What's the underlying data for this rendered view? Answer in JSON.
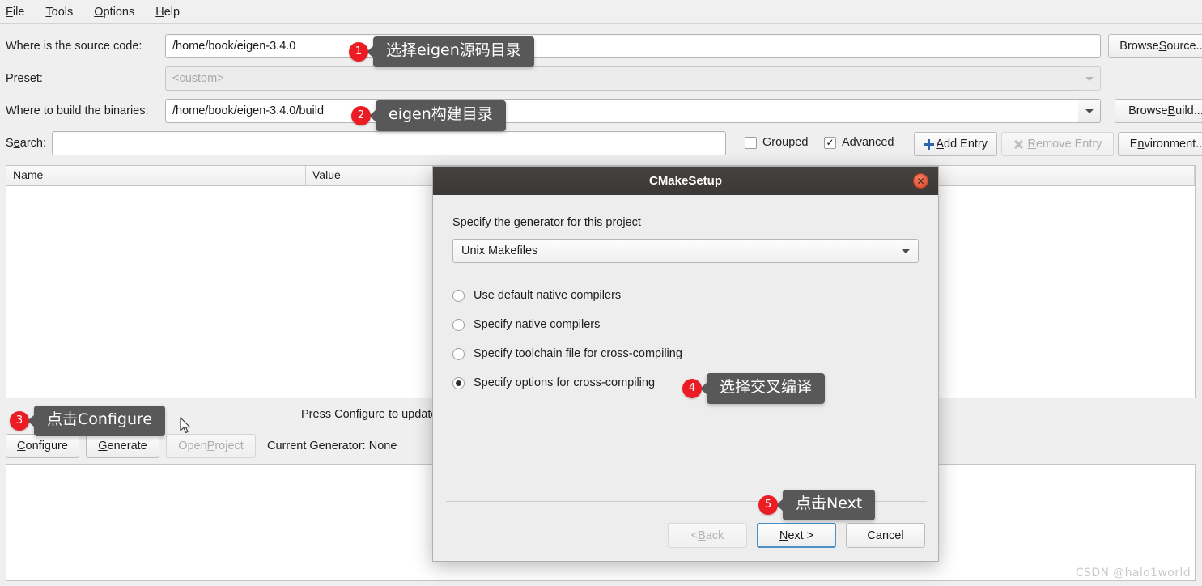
{
  "menubar": {
    "items": [
      {
        "label": "File",
        "mnemonic": "F"
      },
      {
        "label": "Tools",
        "mnemonic": "T"
      },
      {
        "label": "Options",
        "mnemonic": "O"
      },
      {
        "label": "Help",
        "mnemonic": "H"
      }
    ]
  },
  "form": {
    "source_label": "Where is the source code:",
    "source_value": "/home/book/eigen-3.4.0",
    "browse_source_label": "Browse Source...",
    "preset_label": "Preset:",
    "preset_value": "<custom>",
    "build_label": "Where to build the binaries:",
    "build_value": "/home/book/eigen-3.4.0/build",
    "browse_build_label": "Browse Build...",
    "search_label": "Search:",
    "search_value": "",
    "grouped_label": "Grouped",
    "grouped_checked": false,
    "advanced_label": "Advanced",
    "advanced_checked": true,
    "advanced_check_glyph": "✓",
    "add_entry_label": "Add Entry",
    "remove_entry_label": "Remove Entry",
    "environment_label": "Environment..."
  },
  "table": {
    "columns": [
      "Name",
      "Value"
    ],
    "rows": []
  },
  "status": {
    "message": "Press Configure to update",
    "configure_label": "Configure",
    "generate_label": "Generate",
    "open_project_label": "Open Project",
    "current_generator": "Current Generator: None"
  },
  "dialog": {
    "title": "CMakeSetup",
    "close_glyph": "✕",
    "prompt": "Specify the generator for this project",
    "generator_value": "Unix Makefiles",
    "options": [
      {
        "label": "Use default native compilers",
        "selected": false
      },
      {
        "label": "Specify native compilers",
        "selected": false
      },
      {
        "label": "Specify toolchain file for cross-compiling",
        "selected": false
      },
      {
        "label": "Specify options for cross-compiling",
        "selected": true
      }
    ],
    "back_label": "< Back",
    "next_label": "Next >",
    "cancel_label": "Cancel"
  },
  "callouts": [
    {
      "number": "1",
      "text": "选择eigen源码目录"
    },
    {
      "number": "2",
      "text": "eigen构建目录"
    },
    {
      "number": "3",
      "text": "点击Configure"
    },
    {
      "number": "4",
      "text": "选择交叉编译"
    },
    {
      "number": "5",
      "text": "点击Next"
    }
  ],
  "watermark": "CSDN @halo1world",
  "colors": {
    "accent_red": "#ec1c24",
    "callout_bg": "#585858",
    "window_bg": "#efefef",
    "titlebar_bg": "#3f3c39",
    "focus_blue": "#4a90c4"
  }
}
